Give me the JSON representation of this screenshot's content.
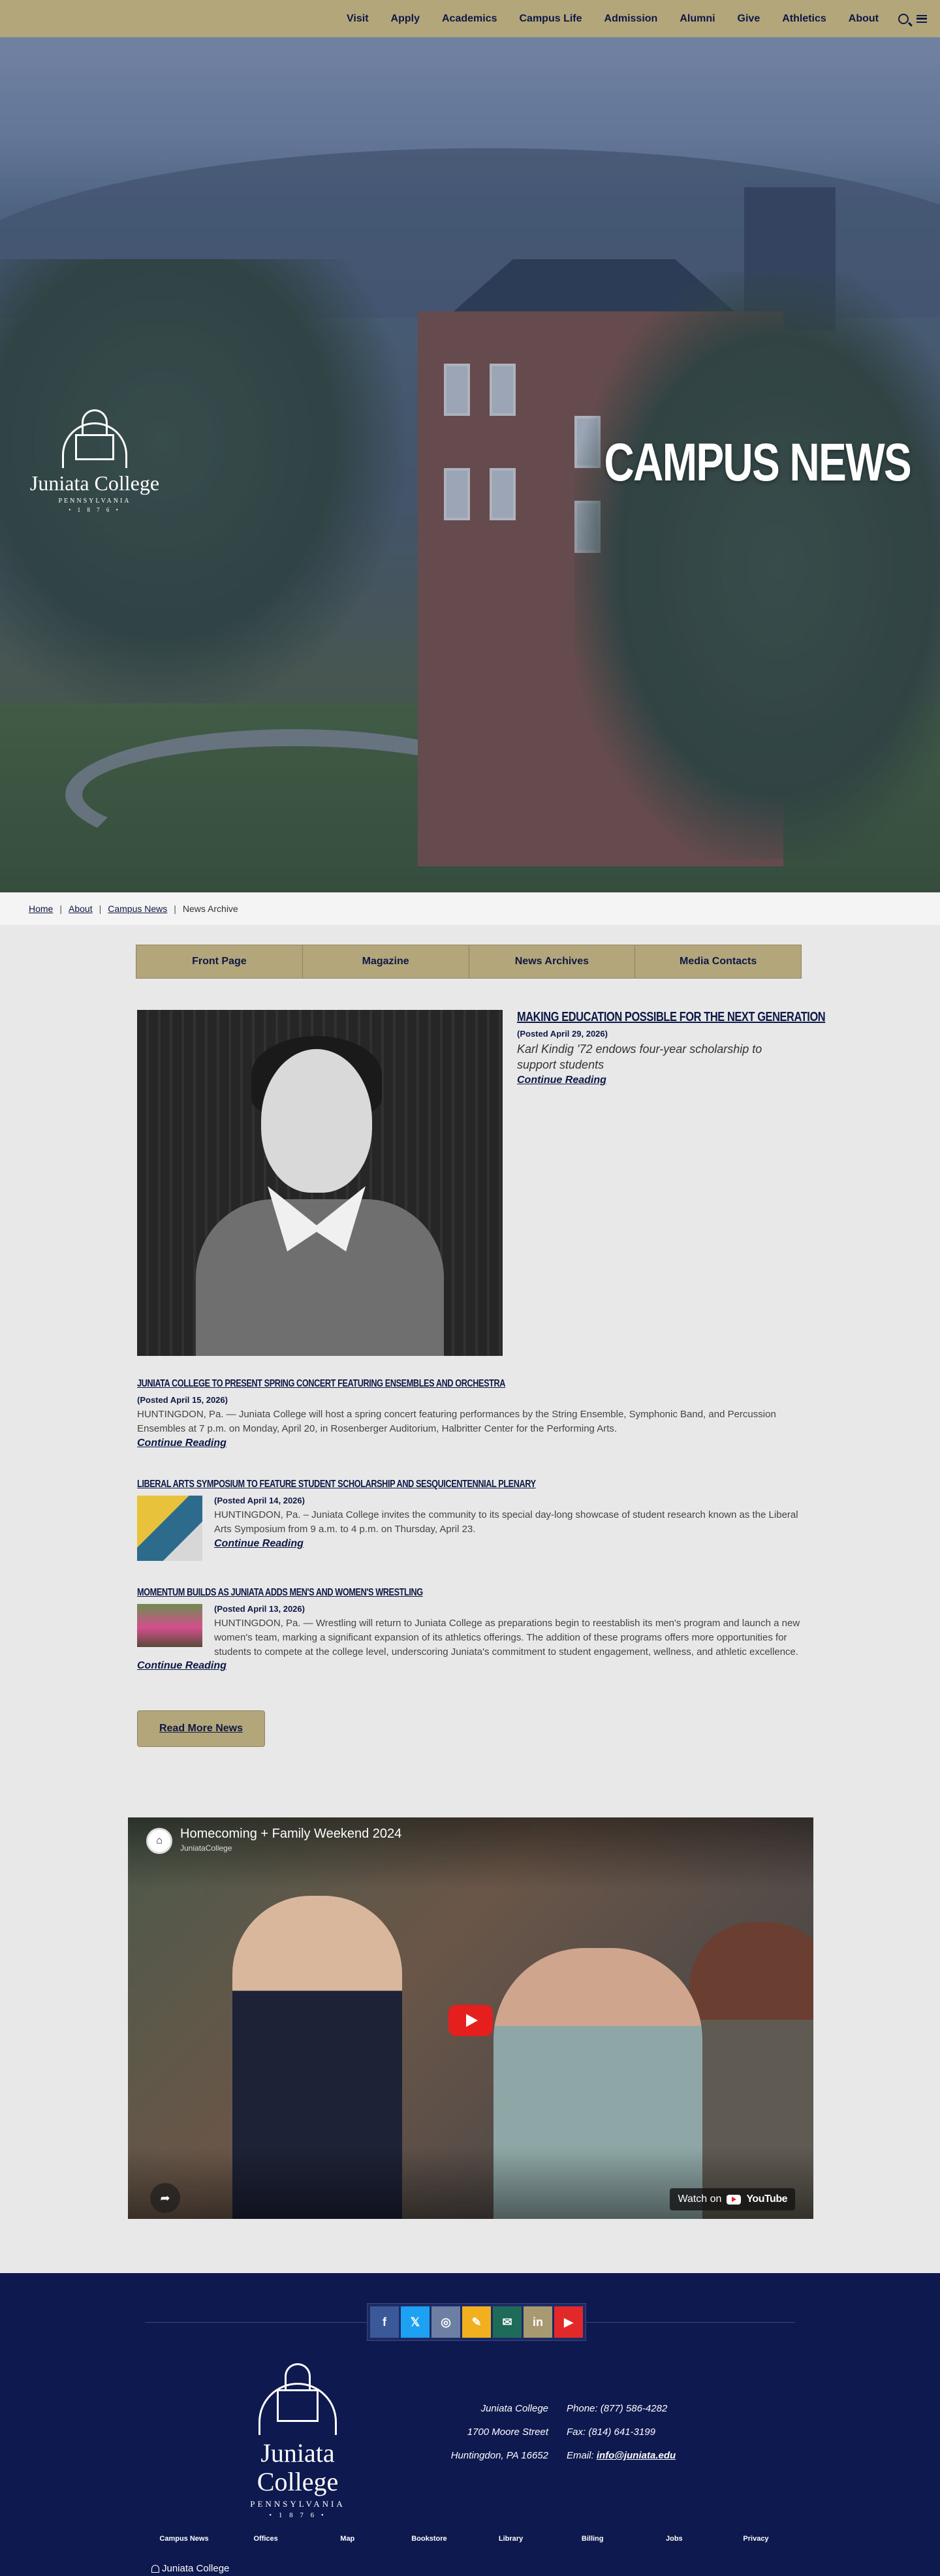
{
  "nav": {
    "items": [
      "Visit",
      "Apply",
      "Academics",
      "Campus Life",
      "Admission",
      "Alumni",
      "Give",
      "Athletics",
      "About"
    ],
    "search_icon": "search-icon",
    "menu_icon": "hamburger-menu-icon"
  },
  "hero": {
    "title": "CAMPUS NEWS",
    "logo": {
      "name": "Juniata College",
      "state": "PENNSYLVANIA",
      "year": "• 1 8 7 6 •"
    }
  },
  "breadcrumb": {
    "home": "Home",
    "about": "About",
    "campus_news": "Campus News",
    "current": "News Archive",
    "sep": "|"
  },
  "subnav": [
    "Front Page",
    "Magazine",
    "News Archives",
    "Media Contacts"
  ],
  "feature": {
    "headline": "MAKING EDUCATION POSSIBLE FOR THE NEXT GENERATION",
    "posted": "(Posted April 29, 2026)",
    "summary": "Karl Kindig '72 endows four-year scholarship to support students",
    "continue": "Continue Reading"
  },
  "stories": [
    {
      "headline": "JUNIATA COLLEGE TO PRESENT SPRING CONCERT FEATURING ENSEMBLES AND ORCHESTRA",
      "posted": "(Posted April 15, 2026)",
      "body": "HUNTINGDON, Pa. — Juniata College will host a spring concert featuring performances by the String Ensemble, Symphonic Band, and Percussion Ensembles at 7 p.m. on Monday, April 20, in Rosenberger Auditorium, Halbritter Center for the Performing Arts.",
      "continue": "Continue Reading"
    },
    {
      "headline": "LIBERAL ARTS SYMPOSIUM TO FEATURE STUDENT SCHOLARSHIP AND SESQUICENTENNIAL PLENARY",
      "posted": "(Posted April 14, 2026)",
      "body": "HUNTINGDON, Pa. – Juniata College invites the community to its special day-long showcase of student research known as the Liberal Arts Symposium from 9 a.m. to 4 p.m. on Thursday, April 23.",
      "continue": "Continue Reading"
    },
    {
      "headline": "MOMENTUM BUILDS AS JUNIATA ADDS MEN'S AND WOMEN'S WRESTLING",
      "posted": "(Posted April 13, 2026)",
      "body": "HUNTINGDON, Pa. — Wrestling will return to Juniata College as preparations begin to reestablish its men's program and launch a new women's team, marking a significant expansion of its athletics offerings. The addition of these programs offers more opportunities for students to compete at the college level, underscoring Juniata's commitment to student engagement, wellness, and athletic excellence.",
      "continue": "Continue Reading"
    }
  ],
  "read_more": "Read More News",
  "video": {
    "title": "Homecoming + Family Weekend 2024",
    "channel": "JuniataCollege",
    "watch_on": "Watch on",
    "youtube": "YouTube"
  },
  "footer": {
    "socials": [
      {
        "icon": "facebook-icon",
        "glyph": "f",
        "color": "#3b5998"
      },
      {
        "icon": "x-icon",
        "glyph": "𝕏",
        "color": "#1da1f2"
      },
      {
        "icon": "instagram-icon",
        "glyph": "◎",
        "color": "#6d7fa3"
      },
      {
        "icon": "blog-icon",
        "glyph": "✎",
        "color": "#f2b01e"
      },
      {
        "icon": "email-icon",
        "glyph": "✉",
        "color": "#1e6b5a"
      },
      {
        "icon": "linkedin-icon",
        "glyph": "in",
        "color": "#a89a70"
      },
      {
        "icon": "youtube-icon",
        "glyph": "▶",
        "color": "#e22828"
      }
    ],
    "logo": {
      "name": "Juniata College",
      "state": "PENNSYLVANIA",
      "year": "• 1 8 7 6 •"
    },
    "address": [
      "Juniata College",
      "1700 Moore Street",
      "Huntingdon, PA 16652"
    ],
    "phone": "Phone: (877) 586-4282",
    "fax": "Fax: (814) 641-3199",
    "email_label": "Email:",
    "email": "info@juniata.edu",
    "links": [
      "Campus News",
      "Offices",
      "Map",
      "Bookstore",
      "Library",
      "Billing",
      "Jobs",
      "Privacy"
    ],
    "brand": "Juniata College"
  }
}
